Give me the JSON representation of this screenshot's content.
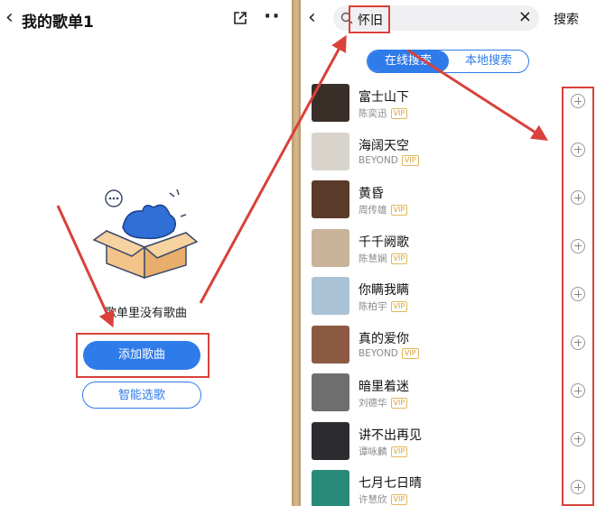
{
  "left": {
    "title": "我的歌单1",
    "back_icon": "chevron-left-icon",
    "share_icon": "share-icon",
    "more_icon": "more-icon",
    "empty_text": "歌单里没有歌曲",
    "add_button": "添加歌曲",
    "smart_button": "智能选歌"
  },
  "right": {
    "back_icon": "chevron-left-icon",
    "search_value": "怀旧",
    "clear_icon": "close-icon",
    "search_button": "搜索",
    "tabs": {
      "online": "在线搜索",
      "local": "本地搜索"
    },
    "vip_label": "VIP",
    "songs": [
      {
        "title": "富士山下",
        "artist": "陈奕迅",
        "cover": "#3a2e28"
      },
      {
        "title": "海阔天空",
        "artist": "BEYOND",
        "cover": "#d8d4cc"
      },
      {
        "title": "黄昏",
        "artist": "周传雄",
        "cover": "#5a3a28"
      },
      {
        "title": "千千阙歌",
        "artist": "陈慧娴",
        "cover": "#c9b39a"
      },
      {
        "title": "你瞒我瞒",
        "artist": "陈柏宇",
        "cover": "#a9c2d6"
      },
      {
        "title": "真的爱你",
        "artist": "BEYOND",
        "cover": "#8c5a42"
      },
      {
        "title": "暗里着迷",
        "artist": "刘德华",
        "cover": "#6e6e6e"
      },
      {
        "title": "讲不出再见",
        "artist": "谭咏麟",
        "cover": "#2c2c30"
      },
      {
        "title": "七月七日晴",
        "artist": "许慧欣",
        "cover": "#2a8a7a"
      }
    ]
  },
  "colors": {
    "accent": "#2f7bea",
    "annotation": "#d9413a",
    "vip": "#d6a23a"
  }
}
